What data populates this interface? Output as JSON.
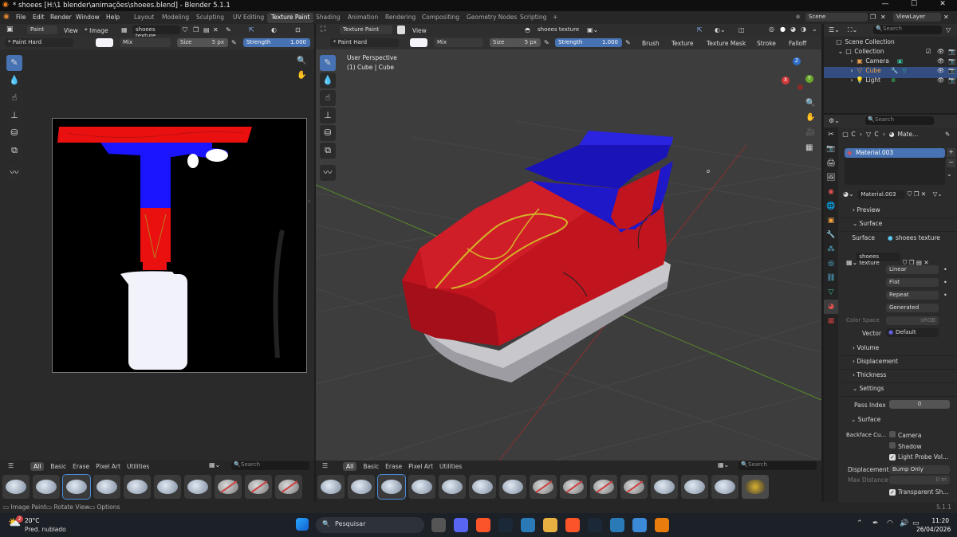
{
  "title_bar": {
    "title": "* shoees [H:\\1 blender\\animações\\shoees.blend] - Blender 5.1.1",
    "minimize": "—",
    "maximize": "☐",
    "close": "✕"
  },
  "menus": [
    "File",
    "Edit",
    "Render",
    "Window",
    "Help"
  ],
  "workspaces": [
    "Layout",
    "Modeling",
    "Sculpting",
    "UV Editing",
    "Texture Paint",
    "Shading",
    "Animation",
    "Rendering",
    "Compositing",
    "Geometry Nodes",
    "Scripting",
    "+"
  ],
  "active_workspace": "Texture Paint",
  "scene": "Scene",
  "view_layer": "ViewLayer",
  "image_editor": {
    "mode": "Paint",
    "view": "View",
    "image_menu": "* Image",
    "texture_name": "shoees texture",
    "tool_settings": {
      "brush": "* Paint Hard",
      "blend": "Mix",
      "size_label": "Size",
      "size": "5 px",
      "strength_label": "Strength",
      "strength": "1.000"
    },
    "tabs": [
      "All",
      "Basic",
      "Erase",
      "Pixel Art",
      "Utilities"
    ],
    "search_placeholder": "Search"
  },
  "viewport": {
    "mode": "Texture Paint",
    "view": "View",
    "texture_name": "shoees texture",
    "overlay_text": [
      "User Perspective",
      "(1) Cube | Cube"
    ],
    "tool_settings": {
      "brush": "* Paint Hard",
      "blend": "Mix",
      "size_label": "Size",
      "size": "5 px",
      "strength_label": "Strength",
      "strength": "1.000",
      "menus": [
        "Brush",
        "Texture",
        "Texture Mask",
        "Stroke",
        "Falloff"
      ]
    },
    "tabs": [
      "All",
      "Basic",
      "Erase",
      "Pixel Art",
      "Utilities"
    ],
    "search_placeholder": "Search",
    "gizmo": {
      "x": "X",
      "y": "Y",
      "z": "Z"
    }
  },
  "outliner": {
    "search_placeholder": "Search",
    "items": [
      {
        "label": "Scene Collection"
      },
      {
        "label": "Collection"
      },
      {
        "label": "Camera"
      },
      {
        "label": "Cube"
      },
      {
        "label": "Light"
      }
    ]
  },
  "properties": {
    "search_placeholder": "Search",
    "breadcrumb": [
      "C",
      "C",
      "Mate..."
    ],
    "material_slot": "Material.003",
    "material_name": "Material.003",
    "sections": {
      "preview": "Preview",
      "surface": "Surface",
      "volume": "Volume",
      "displacement": "Displacement",
      "thickness": "Thickness",
      "settings": "Settings",
      "surface_sub": "Surface"
    },
    "surface_row": {
      "label": "Surface",
      "value": "shoees texture"
    },
    "image_node": "shoees texture",
    "interp": "Linear",
    "projection": "Flat",
    "extension": "Repeat",
    "source": "Generated",
    "color_space_label": "Color Space",
    "color_space": "sRGB",
    "vector_label": "Vector",
    "vector": "Default",
    "pass_index_label": "Pass Index",
    "pass_index": "0",
    "backface_label": "Backface Cu...",
    "checks": [
      {
        "label": "Camera",
        "checked": false
      },
      {
        "label": "Shadow",
        "checked": false
      },
      {
        "label": "Light Probe Vol...",
        "checked": true
      }
    ],
    "displacement_label": "Displacement",
    "displacement_value": "Bump Only",
    "max_distance_label": "Max Distance",
    "max_distance": "0 m",
    "transparent": "Transparent Sh..."
  },
  "status_bar": {
    "items": [
      "Image Paint",
      "Rotate View",
      "Options"
    ],
    "version": "5.1.1"
  },
  "taskbar": {
    "weather_temp": "20°C",
    "weather_desc": "Pred. nublado",
    "weather_badge": "2",
    "search_placeholder": "Pesquisar",
    "time": "11:20",
    "date": "26/04/2026"
  },
  "colors": {
    "accent": "#4772b3",
    "shoe_red": "#c0151f",
    "shoe_blue": "#1a14b8",
    "sole": "#c8c8cc"
  }
}
